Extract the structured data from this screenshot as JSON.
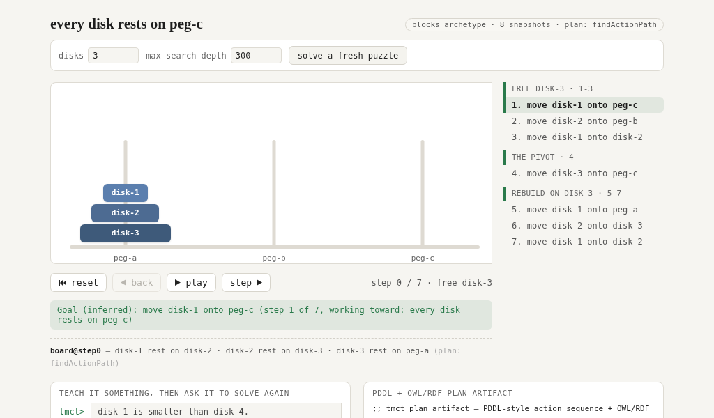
{
  "title": "every disk rests on peg-c",
  "summary": "blocks archetype · 8 snapshots · plan: findActionPath",
  "controls": {
    "fields": [
      {
        "label": "disks",
        "value": "3"
      },
      {
        "label": "max search depth",
        "value": "300"
      }
    ],
    "button": "solve a fresh puzzle"
  },
  "board": {
    "pegs": [
      {
        "label": "peg-a",
        "disks": [
          {
            "label": "disk-1",
            "kind": "small",
            "color": "#5b7fae"
          },
          {
            "label": "disk-2",
            "kind": "medium",
            "color": "#4d6b92"
          },
          {
            "label": "disk-3",
            "kind": "large",
            "color": "#3e5a7a"
          }
        ]
      },
      {
        "label": "peg-b"
      },
      {
        "label": "peg-c"
      }
    ]
  },
  "playback": {
    "buttons": [
      {
        "kind": "reset",
        "label": "reset",
        "disabled": false
      },
      {
        "kind": "back",
        "label": "back",
        "disabled": true
      },
      {
        "kind": "play",
        "label": "play",
        "disabled": false
      },
      {
        "kind": "step",
        "label": "step",
        "disabled": false
      }
    ],
    "status": "step 0 / 7 · free disk-3"
  },
  "goal": "Goal (inferred): move disk-1 onto peg-c (step 1 of 7, working toward: every disk rests on peg-c)",
  "board_state": {
    "label": "board@step0",
    "text": "— disk-1 rest on disk-2 · disk-2 rest on disk-3 · disk-3 rest on peg-a",
    "note": "(plan: findActionPath)"
  },
  "plan": {
    "groups": [
      {
        "title": "FREE DISK-3 · 1-3",
        "items": [
          {
            "label": "1. move disk-1 onto peg-c",
            "selected": true
          },
          {
            "label": "2. move disk-2 onto peg-b",
            "selected": false
          },
          {
            "label": "3. move disk-1 onto disk-2",
            "selected": false
          }
        ]
      },
      {
        "title": "THE PIVOT · 4",
        "items": [
          {
            "label": "4. move disk-3 onto peg-c",
            "selected": false
          }
        ]
      },
      {
        "title": "REBUILD ON DISK-3 · 5-7",
        "items": [
          {
            "label": "5. move disk-1 onto peg-a",
            "selected": false
          },
          {
            "label": "6. move disk-2 onto disk-3",
            "selected": false
          },
          {
            "label": "7. move disk-1 onto disk-2",
            "selected": false
          }
        ]
      }
    ]
  },
  "teach_panel": {
    "title": "TEACH IT SOMETHING, THEN ASK IT TO SOLVE AGAIN",
    "prompt": "tmct>",
    "value": "disk-1 is smaller than disk-4."
  },
  "artifact_panel": {
    "title": "PDDL + OWL/RDF PLAN ARTIFACT",
    "lines": [
      ";; tmct plan artifact — PDDL-style action sequence + OWL/RDF"
    ]
  }
}
